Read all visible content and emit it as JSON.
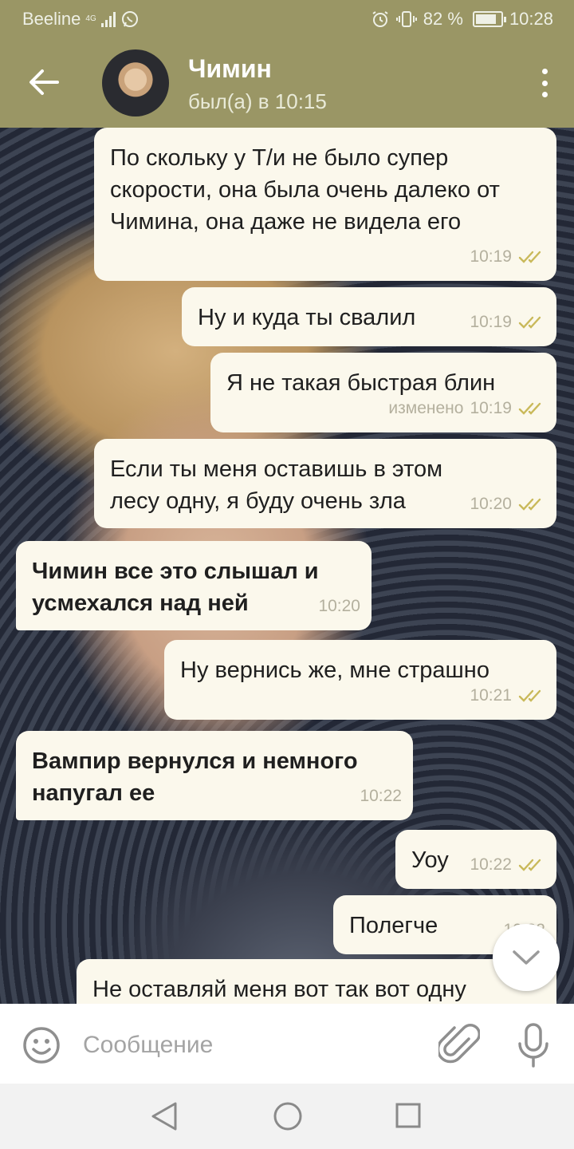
{
  "status_bar": {
    "carrier": "Beeline",
    "network": "4G",
    "battery": "82 %",
    "battery_level": 0.82,
    "time": "10:28"
  },
  "header": {
    "contact_name": "Чимин",
    "last_seen": "был(а) в 10:15"
  },
  "messages": [
    {
      "direction": "out",
      "text": "По скольку у Т/и не было супер скорости, она была очень далеко от Чимина, она даже не видела его",
      "time": "10:19",
      "edited": "",
      "read": true
    },
    {
      "direction": "out",
      "text": "Ну и куда ты свалил",
      "time": "10:19",
      "edited": "",
      "read": true
    },
    {
      "direction": "out",
      "text": "Я не такая быстрая блин",
      "time": "10:19",
      "edited": "изменено",
      "read": true
    },
    {
      "direction": "out",
      "text": "Если ты меня оставишь в этом лесу одну, я буду очень зла",
      "time": "10:20",
      "edited": "",
      "read": true
    },
    {
      "direction": "in",
      "text": "Чимин все это слышал и усмехался над ней",
      "time": "10:20",
      "edited": ""
    },
    {
      "direction": "out",
      "text": "Ну вернись же, мне страшно",
      "time": "10:21",
      "edited": "",
      "read": true
    },
    {
      "direction": "in",
      "text": "Вампир вернулся и немного напугал ее",
      "time": "10:22",
      "edited": ""
    },
    {
      "direction": "out",
      "text": "Уоу",
      "time": "10:22",
      "edited": "",
      "read": true
    },
    {
      "direction": "out",
      "text": "Полегче",
      "time": "10:22",
      "edited": "",
      "read": true
    },
    {
      "direction": "out",
      "text": "Не оставляй меня вот так вот одну",
      "time": "",
      "edited": "",
      "read": true
    }
  ],
  "composer": {
    "placeholder": "Сообщение"
  },
  "icons": {
    "back": "arrow-left-icon",
    "menu": "more-vertical-icon",
    "emoji": "smile-icon",
    "attach": "paperclip-icon",
    "mic": "microphone-icon",
    "scroll_down": "chevron-down-icon"
  },
  "colors": {
    "header": "#9a9665",
    "bubble": "#fbf8ec",
    "check": "#c9b95a"
  }
}
